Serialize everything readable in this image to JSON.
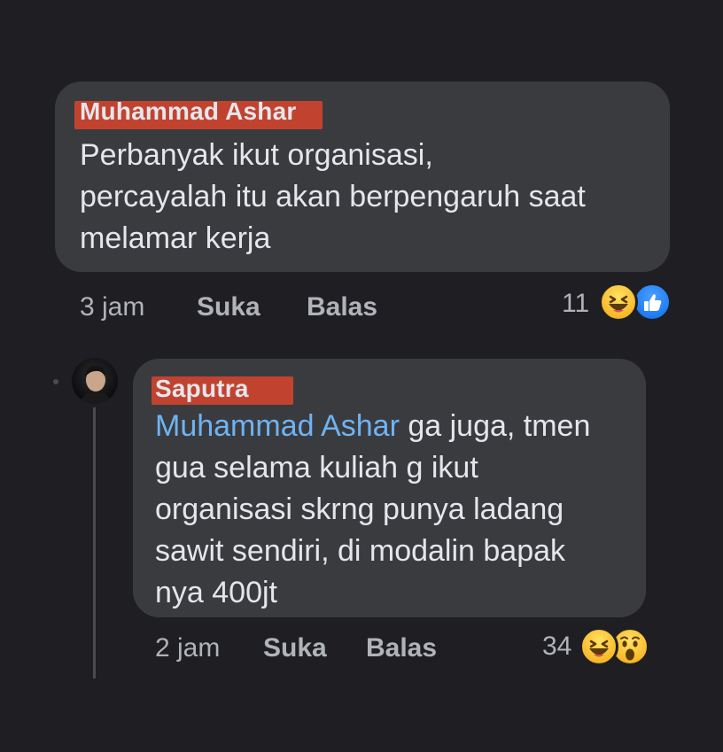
{
  "comments": [
    {
      "author": "Muhammad Ashar",
      "text": "Perbanyak ikut organisasi,\npercayalah itu akan berpengaruh saat\nmelamar kerja",
      "time": "3 jam",
      "like_label": "Suka",
      "reply_label": "Balas",
      "reaction_count": "11",
      "reactions": [
        "haha-icon",
        "like-icon"
      ]
    },
    {
      "author": "Saputra",
      "mention": "Muhammad Ashar",
      "text_after_mention": " ga juga, tmen\ngua selama kuliah g ikut\norganisasi skrng punya ladang\nsawit sendiri, di modalin bapak\nnya 400jt",
      "time": "2 jam",
      "like_label": "Suka",
      "reply_label": "Balas",
      "reaction_count": "34",
      "reactions": [
        "haha-icon",
        "wow-icon"
      ]
    }
  ],
  "colors": {
    "background": "#1f1f23",
    "bubble": "#3a3b3f",
    "mention": "#6fb3f2",
    "redaction": "#d4442e",
    "meta_text": "#b0b3b8"
  }
}
